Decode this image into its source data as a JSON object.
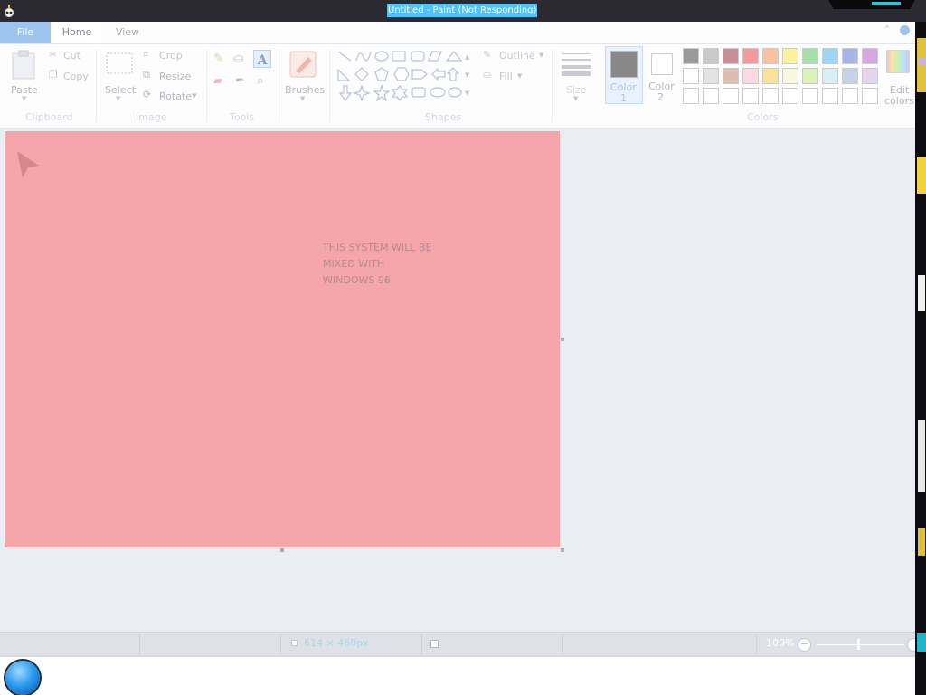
{
  "titlebar": {
    "title": "Untitled - Paint (Not Responding)"
  },
  "tabs": {
    "file": "File",
    "home": "Home",
    "view": "View"
  },
  "ribbon": {
    "clipboard": {
      "paste": "Paste",
      "cut": "Cut",
      "copy": "Copy",
      "group": "Clipboard"
    },
    "image": {
      "select": "Select",
      "crop": "Crop",
      "resize": "Resize",
      "rotate": "Rotate",
      "group": "Image"
    },
    "tools": {
      "text_tool": "A",
      "group": "Tools"
    },
    "brushes": {
      "label": "Brushes"
    },
    "shapes": {
      "outline": "Outline",
      "fill": "Fill",
      "group": "Shapes"
    },
    "size": {
      "label": "Size"
    },
    "color1": {
      "line1": "Color",
      "line2": "1",
      "value": "#888888"
    },
    "color2": {
      "line1": "Color",
      "line2": "2",
      "value": "#ffffff"
    },
    "colors": {
      "group": "Colors",
      "edit_line1": "Edit",
      "edit_line2": "colors",
      "palette_row1": [
        "#9a9a9a",
        "#c9c9c9",
        "#c98f94",
        "#f29aa0",
        "#f8c2a0",
        "#fbf39c",
        "#a7dfa9",
        "#9fd5f1",
        "#a9b3e6",
        "#d4a9e0"
      ],
      "palette_row2": [
        "#ffffff",
        "#e3e3e3",
        "#dcbcae",
        "#fbd9e0",
        "#fbe19a",
        "#f8f8e0",
        "#dcf2bd",
        "#d9eff5",
        "#c6d2e6",
        "#e3d5ec"
      ]
    }
  },
  "canvas": {
    "text_line1": "THIS SYSTEM WILL BE",
    "text_line2": "MIXED WITH",
    "text_line3": "WINDOWS 96",
    "color": "#f4a6aa"
  },
  "statusbar": {
    "dimensions": "614 × 460px",
    "zoom": "100%"
  }
}
